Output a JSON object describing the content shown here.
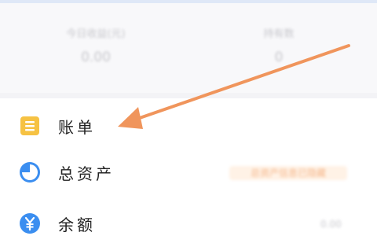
{
  "stats": {
    "left_label": "今日收益(元)",
    "left_value": "0.00",
    "right_label": "持有数",
    "right_value": "0"
  },
  "menu": {
    "items": [
      {
        "label": "账单",
        "icon": "bill-icon",
        "value": ""
      },
      {
        "label": "总资产",
        "icon": "pie-chart-icon",
        "value": "总资产信息已隐藏"
      },
      {
        "label": "余额",
        "icon": "yuan-icon",
        "value": "0.00"
      }
    ]
  },
  "colors": {
    "arrow": "#f0955c",
    "bill_icon": "#f6c243",
    "blue_icon": "#3b8ef0"
  }
}
